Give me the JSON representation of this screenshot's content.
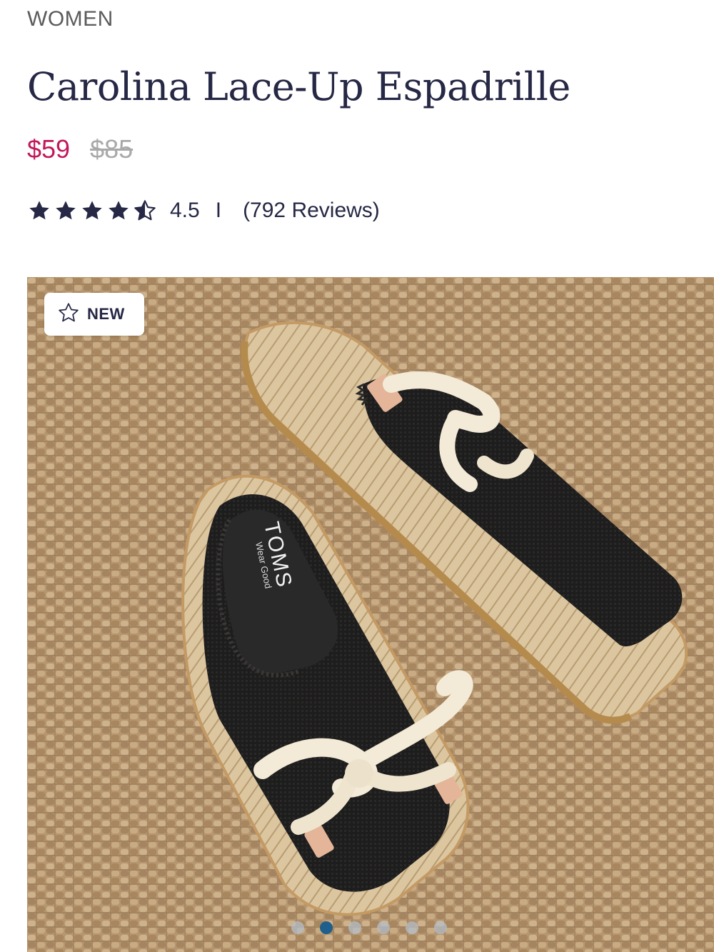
{
  "product": {
    "category": "WOMEN",
    "title": "Carolina Lace-Up Espadrille",
    "price_sale": "$59",
    "price_original": "$85",
    "rating": {
      "stars": 4.5,
      "value": "4.5",
      "separator": "I",
      "reviews": "(792 Reviews)"
    }
  },
  "gallery": {
    "badge": {
      "label": "NEW",
      "icon": "star-outline-icon"
    },
    "insole_brand": "TOMS",
    "insole_tagline": "Wear Good",
    "dots": {
      "count": 6,
      "active_index": 1
    }
  },
  "colors": {
    "title": "#262845",
    "sale": "#c2185b",
    "original": "#a9a9a9",
    "jute": "#b99a72"
  }
}
